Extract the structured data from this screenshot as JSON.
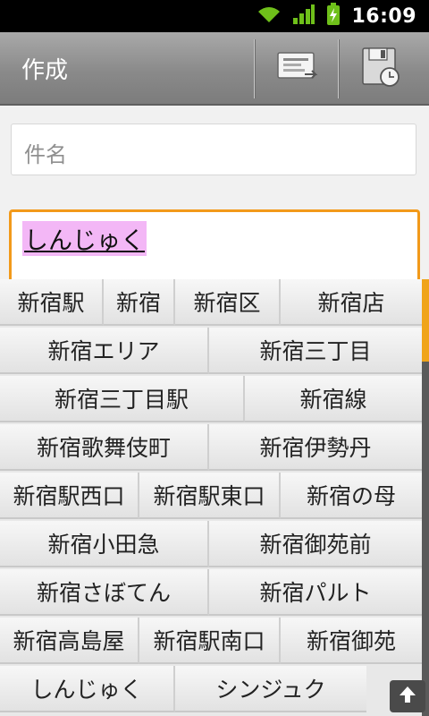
{
  "status": {
    "time": "16:09",
    "wifi_icon": "wifi-icon",
    "signal_icon": "signal-icon",
    "battery_icon": "battery-charging-icon"
  },
  "actionbar": {
    "title": "作成",
    "actions": [
      {
        "name": "insert-template-icon"
      },
      {
        "name": "save-draft-icon"
      }
    ]
  },
  "form": {
    "subject_placeholder": "件名",
    "composing_text": "しんじゅく"
  },
  "candidates": {
    "rows": [
      [
        "新宿駅",
        "新宿",
        "新宿区",
        "新宿店"
      ],
      [
        "新宿エリア",
        "新宿三丁目"
      ],
      [
        "新宿三丁目駅",
        "新宿線"
      ],
      [
        "新宿歌舞伎町",
        "新宿伊勢丹"
      ],
      [
        "新宿駅西口",
        "新宿駅東口",
        "新宿の母"
      ],
      [
        "新宿小田急",
        "新宿御苑前"
      ],
      [
        "新宿さぼてん",
        "新宿パルト"
      ],
      [
        "新宿高島屋",
        "新宿駅南口",
        "新宿御苑"
      ],
      [
        "しんじゅく",
        "シンジュク"
      ]
    ],
    "up_button_icon": "arrow-up-icon"
  },
  "colors": {
    "accent": "#f29a1a",
    "composing_highlight": "#f3b7f6",
    "actionbar": "#8a8a8a"
  }
}
